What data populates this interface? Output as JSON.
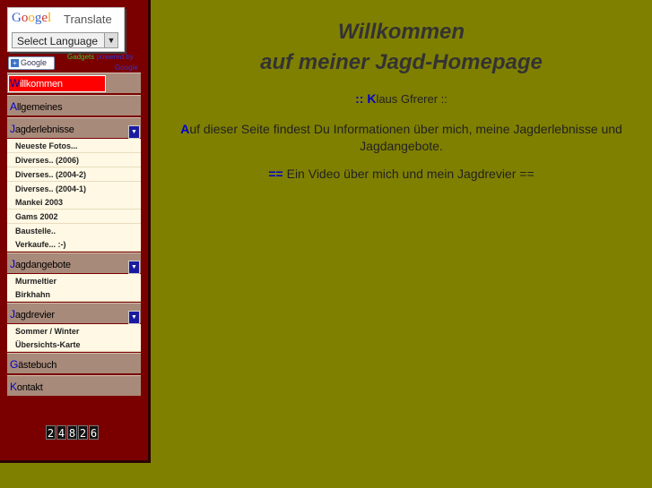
{
  "translate": {
    "logo": [
      "G",
      "o",
      "o",
      "g",
      "l",
      "e"
    ],
    "word": "Translate",
    "select_label": "Select Language",
    "google_button": "Google",
    "gadgets": "Gadgets",
    "powered": "powered by",
    "by_google": "Google"
  },
  "menu": [
    {
      "cap": "W",
      "rest": "illkommen",
      "active": true,
      "expandable": false
    },
    {
      "cap": "A",
      "rest": "llgemeines",
      "active": false,
      "expandable": false
    },
    {
      "cap": "J",
      "rest": "agderlebnisse",
      "active": false,
      "expandable": true
    },
    {
      "cap": "J",
      "rest": "agdangebote",
      "active": false,
      "expandable": true
    },
    {
      "cap": "J",
      "rest": "agdrevier",
      "active": false,
      "expandable": true
    },
    {
      "cap": "G",
      "rest": "ästebuch",
      "active": false,
      "expandable": false
    },
    {
      "cap": "K",
      "rest": "ontakt",
      "active": false,
      "expandable": false
    }
  ],
  "submenus": {
    "jagderlebnisse": [
      "Neueste Fotos...",
      "Diverses.. (2006)",
      "Diverses.. (2004-2)",
      "Diverses.. (2004-1)",
      "Mankei 2003",
      "Gams 2002",
      "Baustelle..",
      "Verkaufe... :-)"
    ],
    "jagdangebote": [
      "Murmeltier",
      "Birkhahn"
    ],
    "jagdrevier": [
      "Sommer / Winter",
      "Übersichts-Karte"
    ]
  },
  "counter": [
    "2",
    "4",
    "8",
    "2",
    "6"
  ],
  "main": {
    "title1": "Willkommen",
    "title2": "auf meiner Jagd-Homepage",
    "author_prefix": ":: ",
    "author_cap": "K",
    "author_rest": "laus Gfrerer ::",
    "intro_cap": "A",
    "intro_rest": "uf dieser Seite findest Du Informationen über mich, meine Jagderlebnisse und Jagdangebote.",
    "video_prefix": "==",
    "video_text": " Ein Video über mich und mein Jagdrevier ==",
    "accent_color": "#0000cc"
  }
}
